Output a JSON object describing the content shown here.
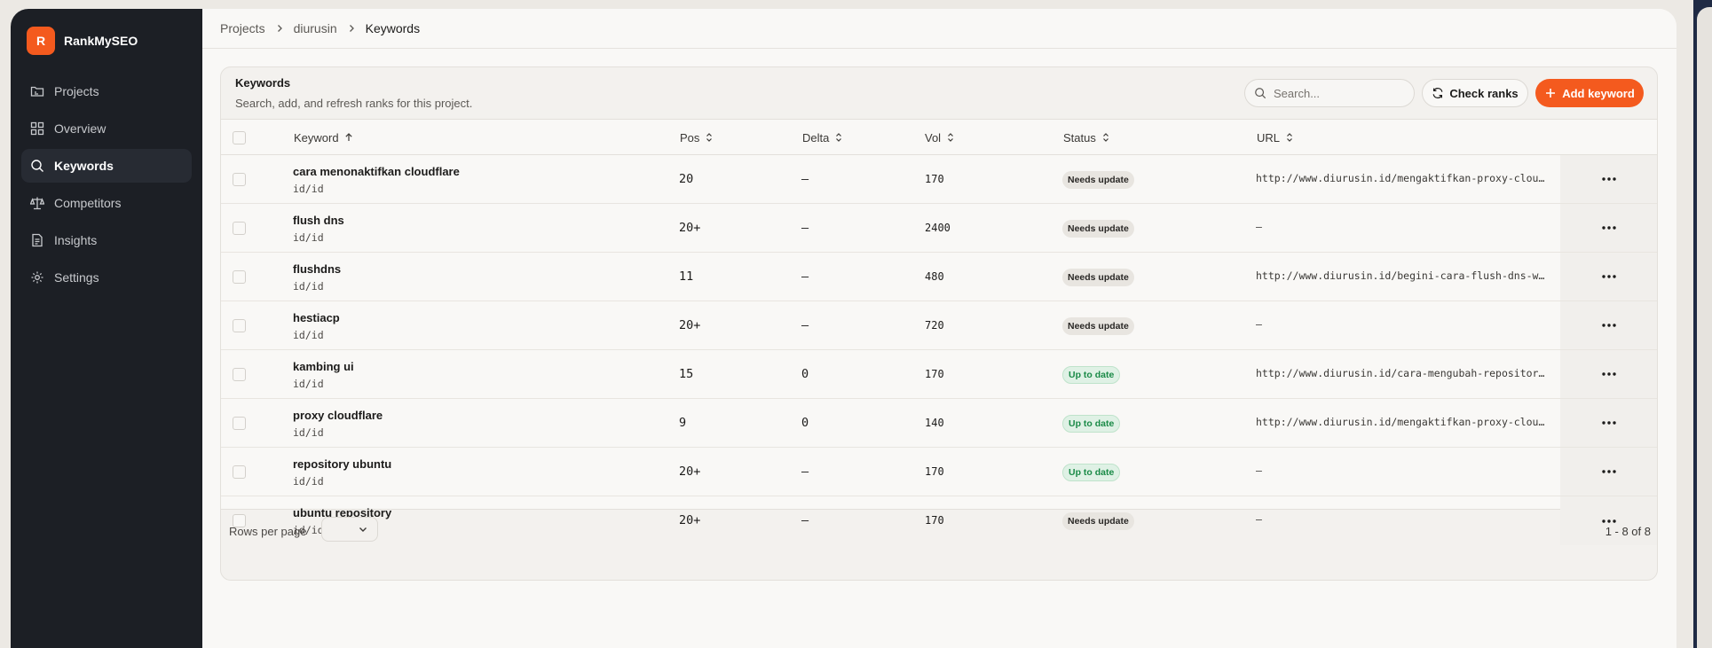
{
  "brand": {
    "logo_letter": "R",
    "name": "RankMySEO"
  },
  "sidebar": {
    "items": [
      {
        "label": "Projects",
        "icon": "folder-icon",
        "active": false
      },
      {
        "label": "Overview",
        "icon": "dashboard-icon",
        "active": false
      },
      {
        "label": "Keywords",
        "icon": "search-icon",
        "active": true
      },
      {
        "label": "Competitors",
        "icon": "scale-icon",
        "active": false
      },
      {
        "label": "Insights",
        "icon": "document-icon",
        "active": false
      },
      {
        "label": "Settings",
        "icon": "gear-icon",
        "active": false
      }
    ]
  },
  "breadcrumb": {
    "items": [
      "Projects",
      "diurusin",
      "Keywords"
    ]
  },
  "card": {
    "title": "Keywords",
    "subtitle": "Search, add, and refresh ranks for this project.",
    "search_placeholder": "Search...",
    "check_ranks_label": "Check ranks",
    "add_keyword_label": "Add keyword"
  },
  "table": {
    "columns": {
      "keyword": "Keyword",
      "pos": "Pos",
      "delta": "Delta",
      "vol": "Vol",
      "status": "Status",
      "url": "URL"
    },
    "rows": [
      {
        "keyword": "cara menonaktifkan cloudflare",
        "locale": "id/id",
        "pos": "20",
        "delta": "—",
        "vol": "170",
        "status": "Needs update",
        "url": "http://www.diurusin.id/mengaktifkan-proxy-cloudflare"
      },
      {
        "keyword": "flush dns",
        "locale": "id/id",
        "pos": "20+",
        "delta": "—",
        "vol": "2400",
        "status": "Needs update",
        "url": "—"
      },
      {
        "keyword": "flushdns",
        "locale": "id/id",
        "pos": "11",
        "delta": "—",
        "vol": "480",
        "status": "Needs update",
        "url": "http://www.diurusin.id/begini-cara-flush-dns-windows"
      },
      {
        "keyword": "hestiacp",
        "locale": "id/id",
        "pos": "20+",
        "delta": "—",
        "vol": "720",
        "status": "Needs update",
        "url": "—"
      },
      {
        "keyword": "kambing ui",
        "locale": "id/id",
        "pos": "15",
        "delta": "0",
        "vol": "170",
        "status": "Up to date",
        "url": "http://www.diurusin.id/cara-mengubah-repository-ubuntu"
      },
      {
        "keyword": "proxy cloudflare",
        "locale": "id/id",
        "pos": "9",
        "delta": "0",
        "vol": "140",
        "status": "Up to date",
        "url": "http://www.diurusin.id/mengaktifkan-proxy-cloudflare"
      },
      {
        "keyword": "repository ubuntu",
        "locale": "id/id",
        "pos": "20+",
        "delta": "—",
        "vol": "170",
        "status": "Up to date",
        "url": "—"
      },
      {
        "keyword": "ubuntu repository",
        "locale": "id/id",
        "pos": "20+",
        "delta": "—",
        "vol": "170",
        "status": "Needs update",
        "url": "—"
      }
    ]
  },
  "footer": {
    "rows_per_page_label": "Rows per page",
    "pagination": "1 - 8 of 8"
  },
  "colors": {
    "accent": "#f45a1e",
    "sidebar_bg": "#1c1f25",
    "ok_text": "#1a8a47",
    "ok_bg": "#dff1e5"
  }
}
